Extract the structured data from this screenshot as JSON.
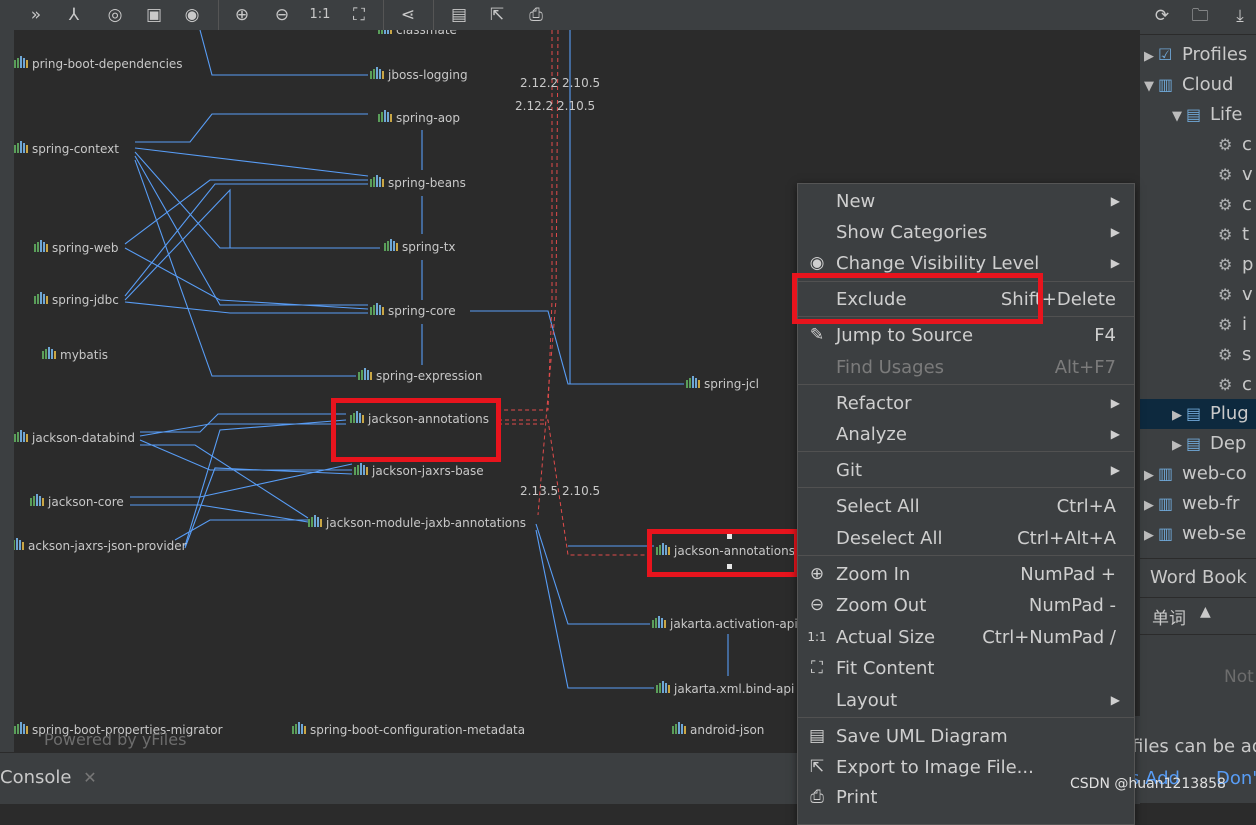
{
  "diagram": {
    "nodes": [
      {
        "label": "classmate"
      },
      {
        "label": "pring-boot-dependencies"
      },
      {
        "label": "jboss-logging"
      },
      {
        "label": "spring-aop"
      },
      {
        "label": "spring-context"
      },
      {
        "label": "spring-beans"
      },
      {
        "label": "spring-web"
      },
      {
        "label": "spring-tx"
      },
      {
        "label": "spring-jdbc"
      },
      {
        "label": "spring-core"
      },
      {
        "label": "mybatis"
      },
      {
        "label": "spring-expression"
      },
      {
        "label": "spring-jcl"
      },
      {
        "label": "jackson-annotations"
      },
      {
        "label": "jackson-databind"
      },
      {
        "label": "jackson-jaxrs-base"
      },
      {
        "label": "jackson-core"
      },
      {
        "label": "jackson-module-jaxb-annotations"
      },
      {
        "label": "ackson-jaxrs-json-provider"
      },
      {
        "label": "jackson-annotations"
      },
      {
        "label": "jakarta.activation-api"
      },
      {
        "label": "jakarta.xml.bind-api"
      },
      {
        "label": "spring-boot-properties-migrator"
      },
      {
        "label": "spring-boot-configuration-metadata"
      },
      {
        "label": "android-json"
      }
    ],
    "versions": [
      "2.12.2 2.10.5",
      "2.12.2 2.10.5",
      "2.13.5 2.10.5"
    ],
    "powered_by": "Powered by yFiles",
    "highlight_color": "#e8141d",
    "edge_color": "#589df6",
    "conflict_color": "#e04b4b"
  },
  "context_menu": {
    "items": [
      {
        "label": "New",
        "shortcut": "",
        "submenu": true,
        "icon": ""
      },
      {
        "label": "Show Categories",
        "shortcut": "",
        "submenu": true,
        "icon": ""
      },
      {
        "label": "Change Visibility Level",
        "shortcut": "",
        "submenu": true,
        "icon": "eye-icon"
      },
      {
        "label": "Exclude",
        "shortcut": "Shift+Delete",
        "submenu": false,
        "icon": ""
      },
      {
        "label": "Jump to Source",
        "shortcut": "F4",
        "submenu": false,
        "icon": "pencil-icon"
      },
      {
        "label": "Find Usages",
        "shortcut": "Alt+F7",
        "submenu": false,
        "icon": "",
        "disabled": true
      },
      {
        "label": "Refactor",
        "shortcut": "",
        "submenu": true,
        "icon": ""
      },
      {
        "label": "Analyze",
        "shortcut": "",
        "submenu": true,
        "icon": ""
      },
      {
        "label": "Git",
        "shortcut": "",
        "submenu": true,
        "icon": ""
      },
      {
        "label": "Select All",
        "shortcut": "Ctrl+A",
        "submenu": false,
        "icon": ""
      },
      {
        "label": "Deselect All",
        "shortcut": "Ctrl+Alt+A",
        "submenu": false,
        "icon": ""
      },
      {
        "label": "Zoom In",
        "shortcut": "NumPad +",
        "submenu": false,
        "icon": "zoom-in-icon"
      },
      {
        "label": "Zoom Out",
        "shortcut": "NumPad -",
        "submenu": false,
        "icon": "zoom-out-icon"
      },
      {
        "label": "Actual Size",
        "shortcut": "Ctrl+NumPad /",
        "submenu": false,
        "icon": "actual-size-icon"
      },
      {
        "label": "Fit Content",
        "shortcut": "",
        "submenu": false,
        "icon": "fit-content-icon"
      },
      {
        "label": "Layout",
        "shortcut": "",
        "submenu": true,
        "icon": ""
      },
      {
        "label": "Save UML Diagram",
        "shortcut": "",
        "submenu": false,
        "icon": "save-icon"
      },
      {
        "label": "Export to Image File...",
        "shortcut": "",
        "submenu": false,
        "icon": "export-icon"
      },
      {
        "label": "Print",
        "shortcut": "",
        "submenu": false,
        "icon": "print-icon"
      }
    ]
  },
  "right_panel": {
    "tree": [
      {
        "label": "Profiles"
      },
      {
        "label": "Cloud"
      },
      {
        "label": "Life"
      },
      {
        "label": "c"
      },
      {
        "label": "v"
      },
      {
        "label": "c"
      },
      {
        "label": "t"
      },
      {
        "label": "p"
      },
      {
        "label": "v"
      },
      {
        "label": "i"
      },
      {
        "label": "s"
      },
      {
        "label": "c"
      },
      {
        "label": "Plug"
      },
      {
        "label": "Dep"
      },
      {
        "label": "web-co"
      },
      {
        "label": "web-fr"
      },
      {
        "label": "web-se"
      }
    ],
    "wordbook_title": "Word Book",
    "wordbook_column": "单词",
    "wordbook_empty": "Not"
  },
  "notification": {
    "text": "files can be ad",
    "link1": "s Add",
    "link2": "Don'"
  },
  "bottom": {
    "console_tab": "Console"
  },
  "watermark": "CSDN @huan1213858"
}
